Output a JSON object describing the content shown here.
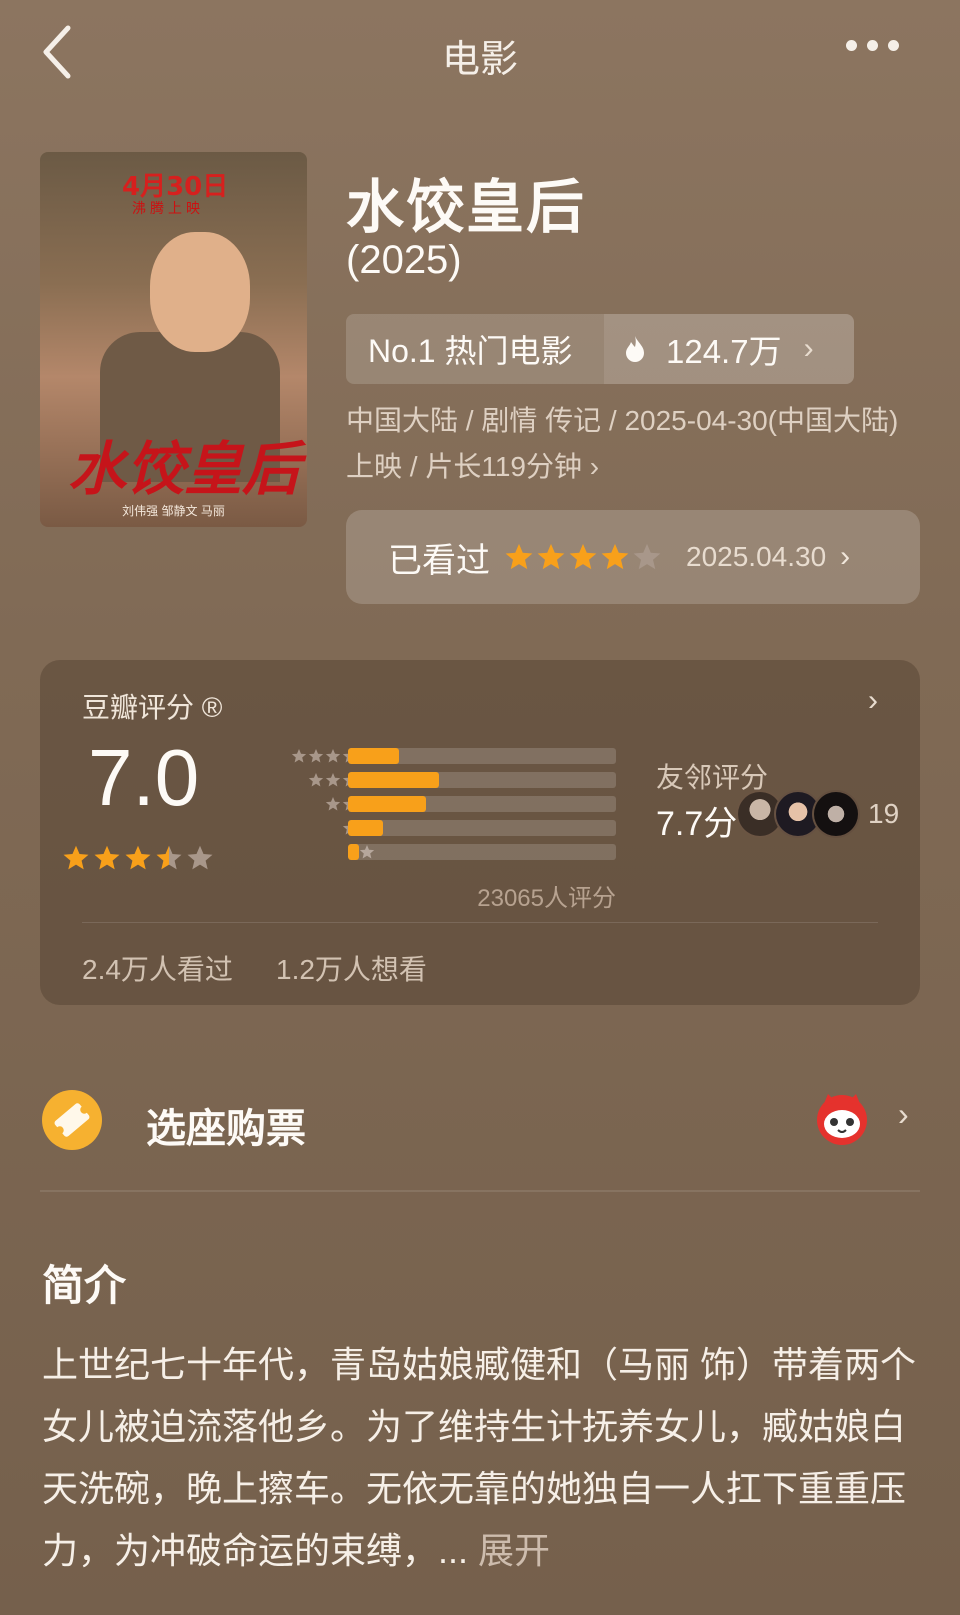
{
  "nav": {
    "title": "电影"
  },
  "poster": {
    "date_text": "4月30日",
    "sub_text": "沸腾上映",
    "title_text": "水饺皇后",
    "credits": "刘伟强  邹静文  马丽"
  },
  "movie": {
    "title": "水饺皇后",
    "year": "(2025)",
    "hot_rank": "No.1 热门电影",
    "hot_value": "124.7万",
    "meta": "中国大陆 / 剧情 传记 / 2025-04-30(中国大陆)上映 / 片长119分钟 ›"
  },
  "watched": {
    "label": "已看过",
    "rating_stars": 4,
    "max_stars": 5,
    "date": "2025.04.30"
  },
  "douban": {
    "title": "豆瓣评分 ®",
    "score": "7.0",
    "score_stars": 3.5,
    "distribution": [
      {
        "stars": 5,
        "fraction": 0.19
      },
      {
        "stars": 4,
        "fraction": 0.34
      },
      {
        "stars": 3,
        "fraction": 0.29
      },
      {
        "stars": 2,
        "fraction": 0.13
      },
      {
        "stars": 1,
        "fraction": 0.04
      }
    ],
    "votes": "23065人评分",
    "seen": "2.4万人看过",
    "want": "1.2万人想看",
    "friend_title": "友邻评分",
    "friend_score": "7.7分",
    "friend_count": "19"
  },
  "ticket": {
    "label": "选座购票"
  },
  "intro": {
    "title": "简介",
    "text": "上世纪七十年代，青岛姑娘臧健和（马丽 饰）带着两个女儿被迫流落他乡。为了维持生计抚养女儿，臧姑娘白天洗碗，晚上擦车。无依无靠的她独自一人扛下重重压力，为冲破命运的束缚，... ",
    "expand": "展开"
  },
  "colors": {
    "accent": "#f8a01a",
    "star_empty": "#a8978a",
    "background": "#806a55"
  }
}
